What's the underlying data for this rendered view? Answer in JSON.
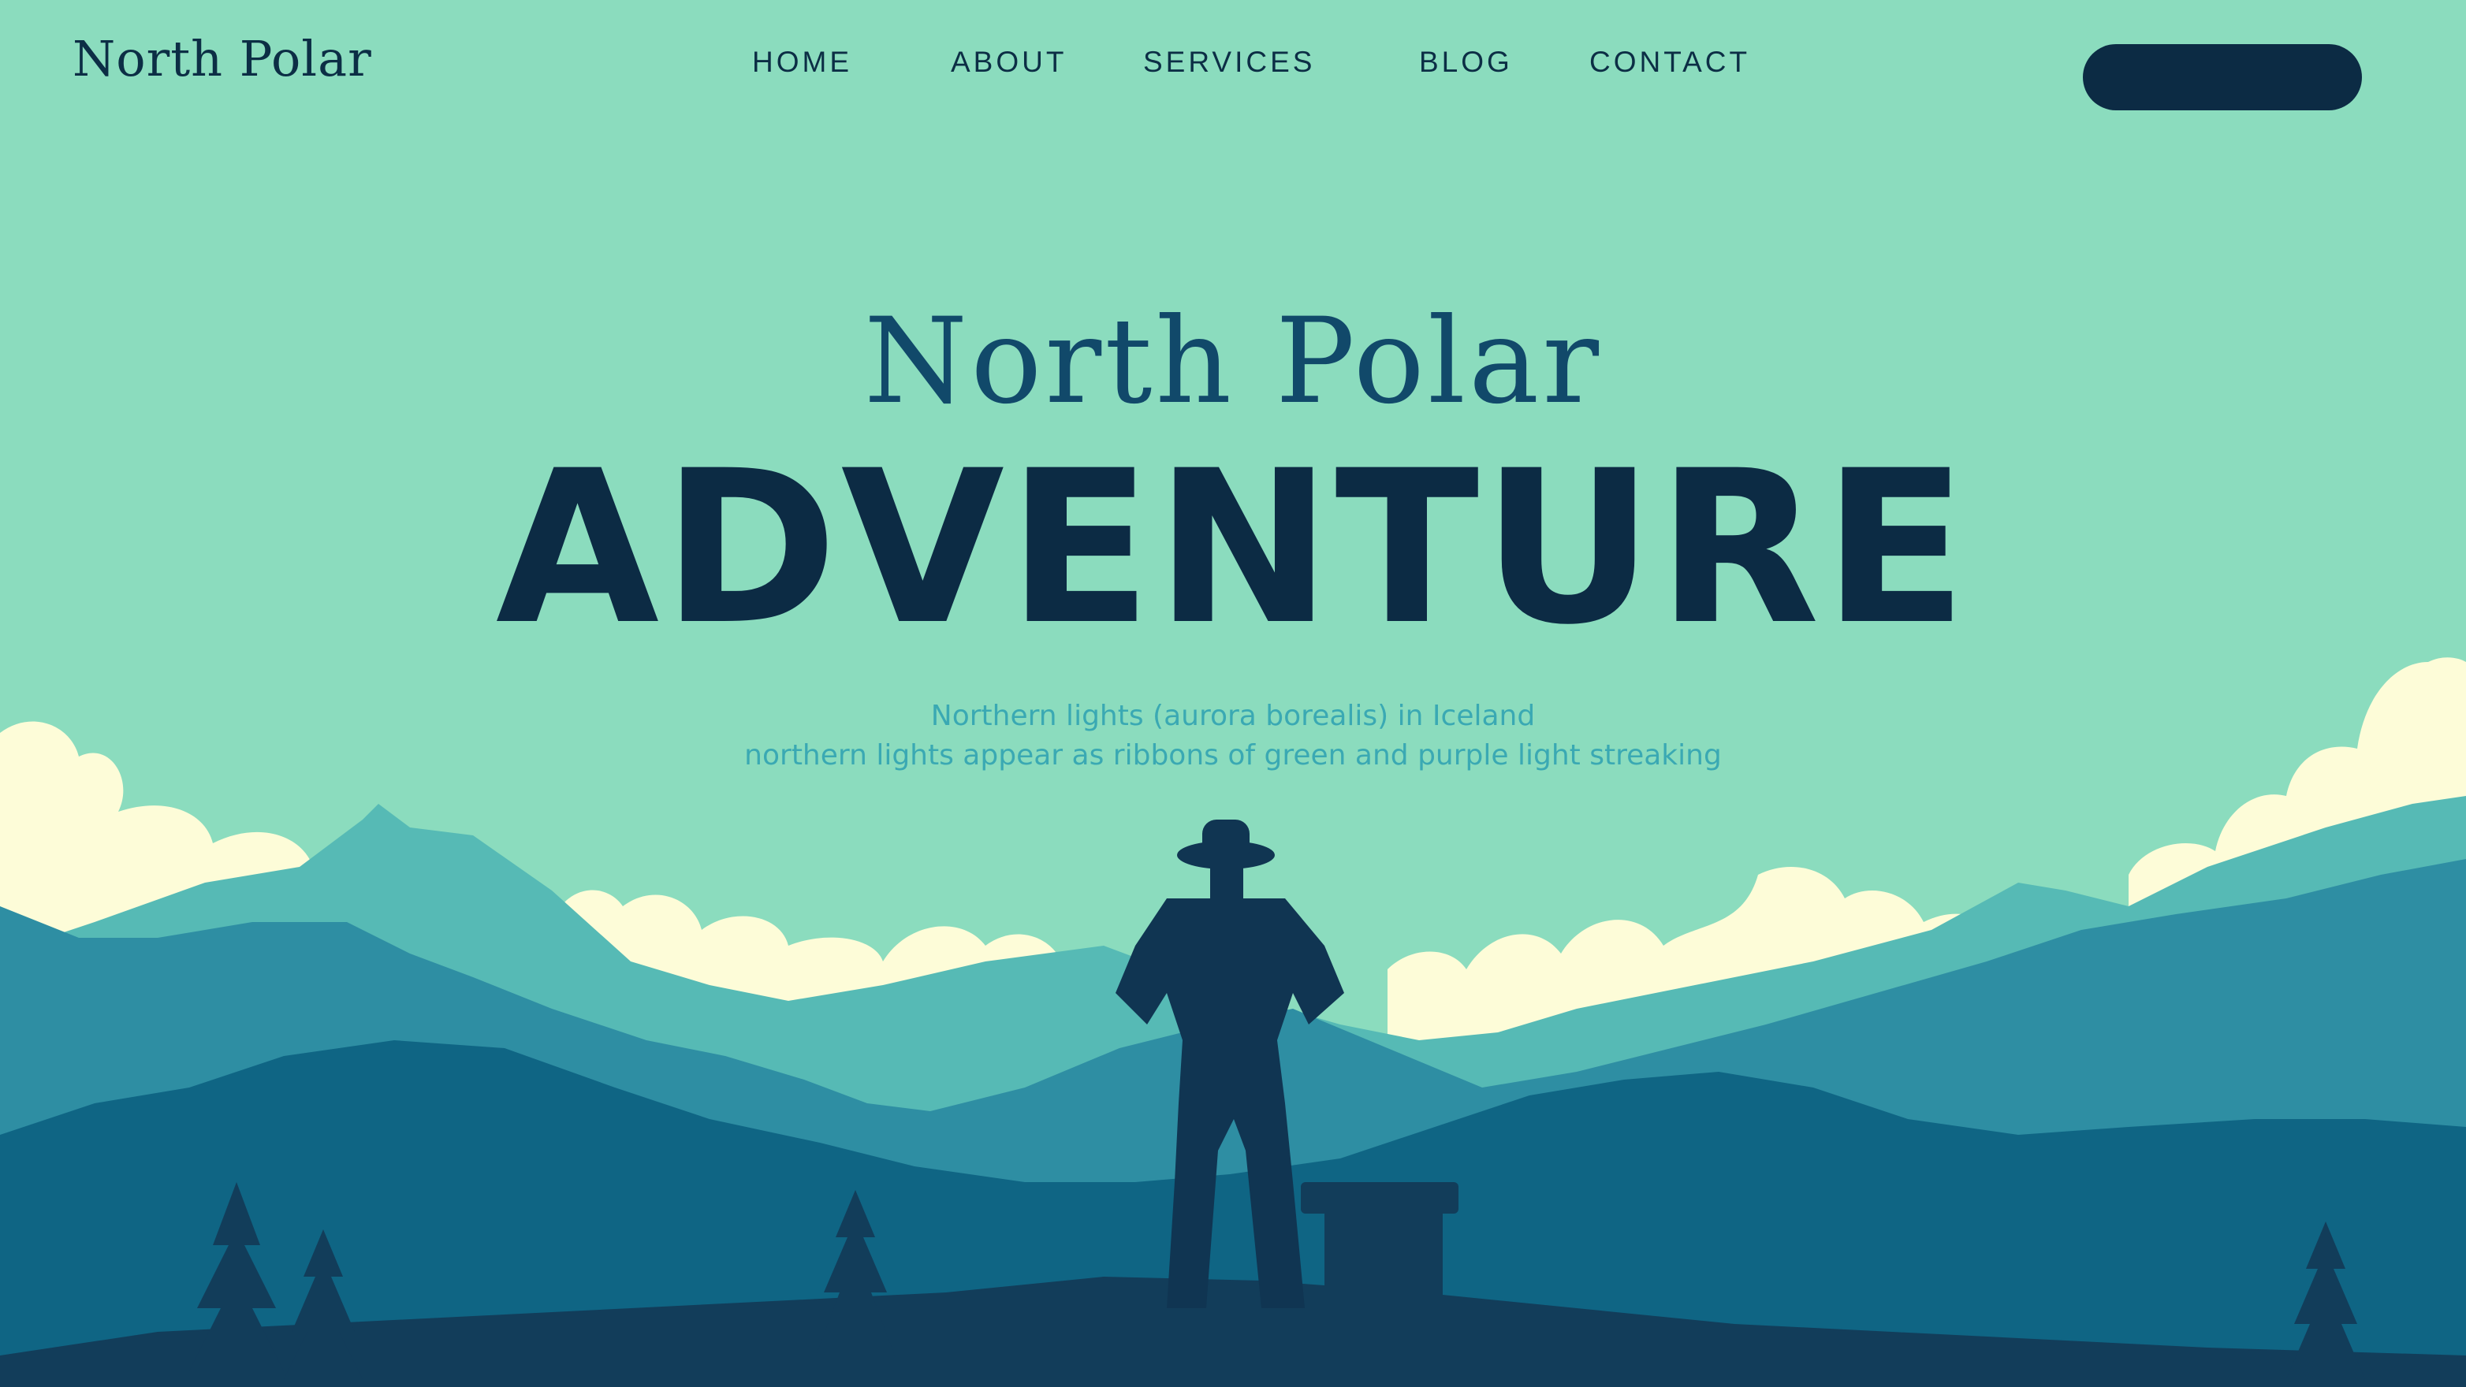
{
  "header": {
    "logo": "North Polar",
    "nav": [
      "HOME",
      "ABOUT",
      "SERVICES",
      "BLOG",
      "CONTACT"
    ],
    "cta_label": ""
  },
  "hero": {
    "script_title": "North Polar",
    "main_title": "ADVENTURE",
    "subtitle_line1": "Northern lights (aurora borealis) in Iceland",
    "subtitle_line2": "northern lights appear as ribbons of green and purple light streaking"
  },
  "colors": {
    "sky": "#8bdcbe",
    "navy": "#0c2b44",
    "cloud": "#fdfcd8",
    "mountain_light": "#56bab5",
    "mountain_mid": "#2e8ea3",
    "mountain_dark": "#0f6584",
    "foreground": "#123d5a"
  }
}
